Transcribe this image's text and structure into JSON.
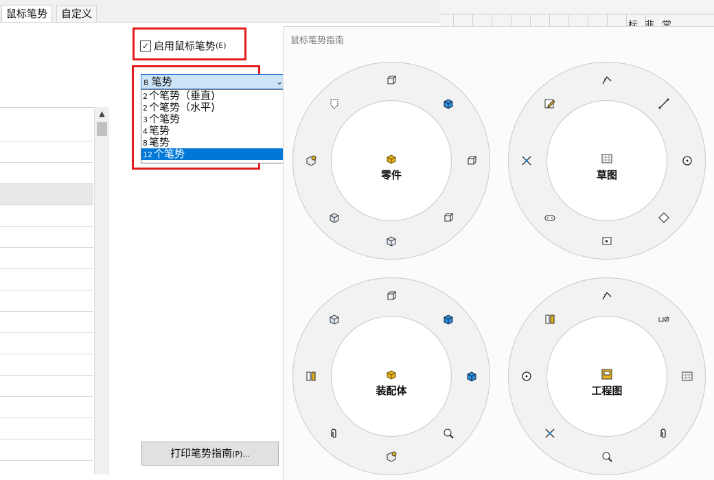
{
  "tabs": [
    {
      "label": "鼠标笔势"
    },
    {
      "label": "自定义"
    }
  ],
  "grid_headers": [
    "标",
    "非",
    "常"
  ],
  "checkbox": {
    "label": "启用鼠标笔势",
    "accel": "(E)",
    "checked": true
  },
  "dropdown": {
    "selected": {
      "num": "8",
      "text": "笔势"
    },
    "options": [
      {
        "num": "2",
        "text": "个笔势（垂直)"
      },
      {
        "num": "2",
        "text": "个笔势（水平)"
      },
      {
        "num": "3",
        "text": "个笔势"
      },
      {
        "num": "4",
        "text": "笔势"
      },
      {
        "num": "8",
        "text": "笔势"
      },
      {
        "num": "12",
        "text": "个笔势"
      }
    ],
    "highlighted_index": 5
  },
  "print_button": {
    "label": "打印笔势指南",
    "accel": "(P)..."
  },
  "guide": {
    "title": "鼠标笔势指南",
    "wheels": [
      {
        "label": "零件",
        "center_icon": "part-icon",
        "icons": [
          "front-view-icon",
          "iso-view-icon",
          "right-view-icon",
          "right-side-view-icon",
          "bottom-view-icon",
          "left-view-icon",
          "normal-to-icon",
          "hidden-lines-icon"
        ]
      },
      {
        "label": "草图",
        "center_icon": "sketch-icon",
        "icons": [
          "arc-icon",
          "line-icon",
          "circle-icon",
          "polygon-icon",
          "rectangle-icon",
          "slot-icon",
          "trim-icon",
          "edit-sketch-icon"
        ]
      },
      {
        "label": "装配体",
        "center_icon": "assembly-icon",
        "icons": [
          "front-view-icon",
          "iso-view-icon",
          "insert-part-icon",
          "zoom-selection-icon",
          "section-view-icon",
          "mate-icon",
          "explode-icon",
          "top-view-icon"
        ]
      },
      {
        "label": "工程图",
        "center_icon": "drawing-icon",
        "icons": [
          "arc-icon",
          "smart-dimension-icon",
          "table-icon",
          "annotation-icon",
          "detail-view-icon",
          "fillet-icon",
          "balloon-icon",
          "weld-symbol-icon"
        ]
      }
    ]
  },
  "colors": {
    "accent": "#0078d7",
    "highlight": "#e41b1b",
    "combo_bg": "#cce4f7"
  }
}
